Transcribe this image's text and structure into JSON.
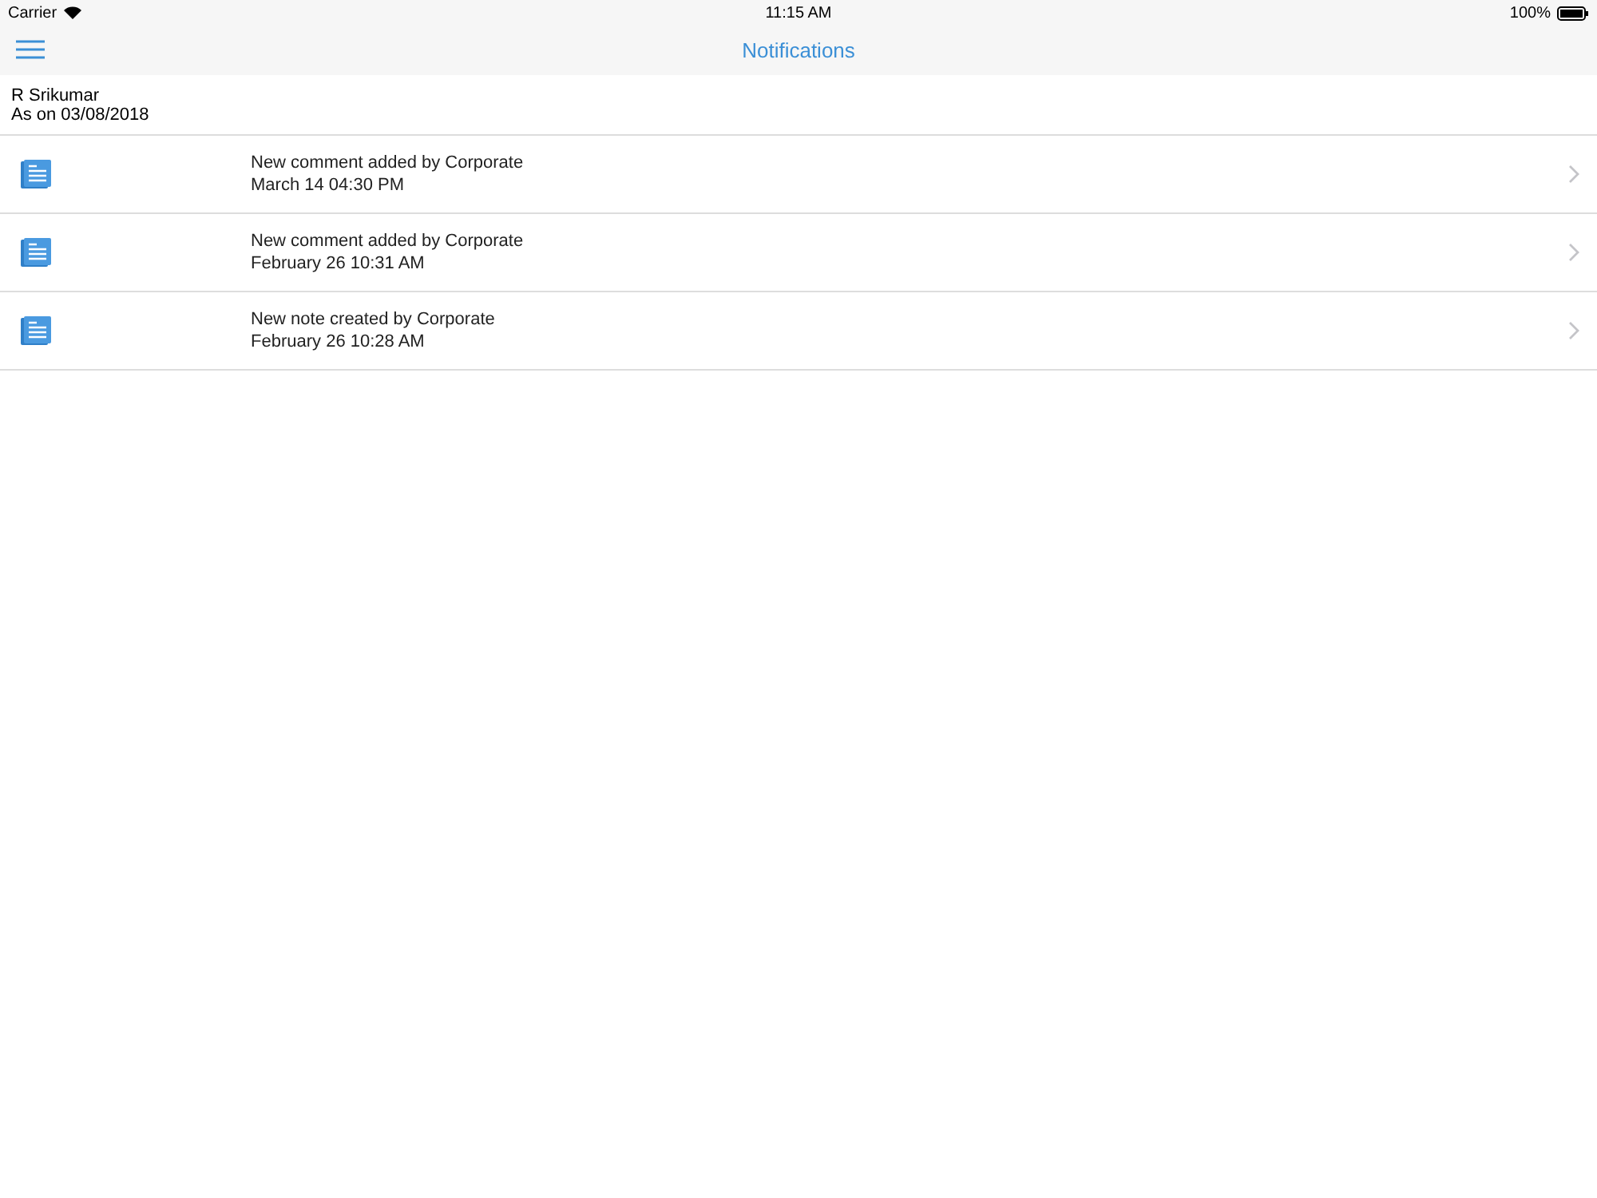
{
  "status_bar": {
    "carrier": "Carrier",
    "time": "11:15 AM",
    "battery": "100%"
  },
  "nav_bar": {
    "title": "Notifications"
  },
  "header": {
    "name": "R Srikumar",
    "as_on": "As on 03/08/2018"
  },
  "notifications": [
    {
      "title": "New comment added by Corporate",
      "time": "March 14 04:30 PM"
    },
    {
      "title": "New comment added by Corporate",
      "time": "February 26 10:31 AM"
    },
    {
      "title": "New note created by Corporate",
      "time": "February 26 10:28 AM"
    }
  ]
}
